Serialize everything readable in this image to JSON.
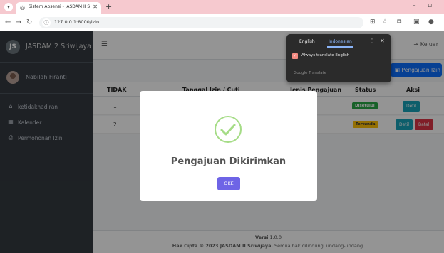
{
  "browser": {
    "tab_title": "Sistem Absensi - JASDAM II Sriw",
    "url": "127.0.0.1:8000/izin"
  },
  "sidebar": {
    "brand": "JASDAM 2 Sriwijaya",
    "user": "Nabilah Firanti",
    "items": [
      {
        "label": "ketidakhadiran",
        "icon": "home-icon"
      },
      {
        "label": "Kalender",
        "icon": "calendar-icon"
      },
      {
        "label": "Permohonan Izin",
        "icon": "print-icon"
      }
    ]
  },
  "topbar": {
    "logout_label": "Keluar"
  },
  "main": {
    "new_button_label": "Pengajuan Izin",
    "table": {
      "headers": [
        "TIDAK",
        "Tanggal Izin / Cuti",
        "Jenis Pengajuan",
        "Status",
        "Aksi"
      ],
      "rows": [
        {
          "no": "1",
          "status": "Disetujui",
          "actions": [
            "Detil"
          ]
        },
        {
          "no": "2",
          "status": "Tertunda",
          "actions": [
            "Detil",
            "Batal"
          ]
        }
      ]
    }
  },
  "footer": {
    "version_label": "Versi",
    "version_value": "1.0.0",
    "copyright_bold": "Hak Cipta © 2023 JASDAM II Sriwijaya.",
    "copyright_rest": "Semua hak dilindungi undang-undang."
  },
  "modal": {
    "title": "Pengajuan Dikirimkan",
    "ok_label": "OKE"
  },
  "translate_popup": {
    "tab_english": "English",
    "tab_indonesian": "Indonesian",
    "checkbox_label": "Always translate English",
    "provider": "Google Translate"
  },
  "colors": {
    "tabstrip": "#f6c9cf",
    "sidebar": "#343a40",
    "primary": "#0d6efd",
    "success_badge": "#28a745",
    "warning_badge": "#ffc107",
    "danger": "#dc3545",
    "info": "#17a2b8",
    "ok_button": "#6e64e6",
    "check_green": "#a5dc86"
  }
}
